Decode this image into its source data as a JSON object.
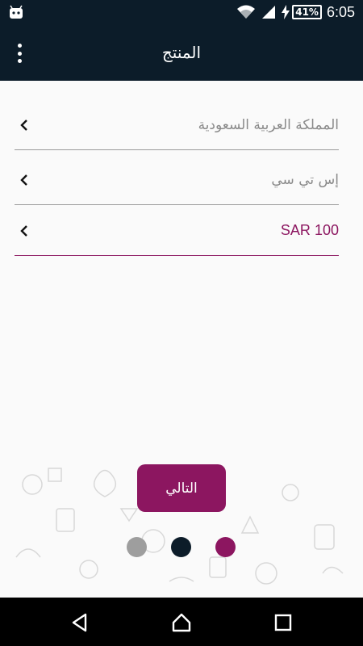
{
  "status_bar": {
    "battery_percent": "41%",
    "time": "6:05"
  },
  "app_bar": {
    "title": "المنتج"
  },
  "form": {
    "country": "المملكة العربية السعودية",
    "operator": "إس تي سي",
    "amount": "100 SAR"
  },
  "actions": {
    "next_label": "التالي"
  },
  "pager": {
    "dots": [
      {
        "color": "#9e9e9e"
      },
      {
        "color": "#0c1c29"
      },
      {
        "color": "#8c1660"
      }
    ]
  },
  "colors": {
    "primary_dark": "#0c1c29",
    "accent": "#8c1660",
    "background": "#fafafa"
  }
}
